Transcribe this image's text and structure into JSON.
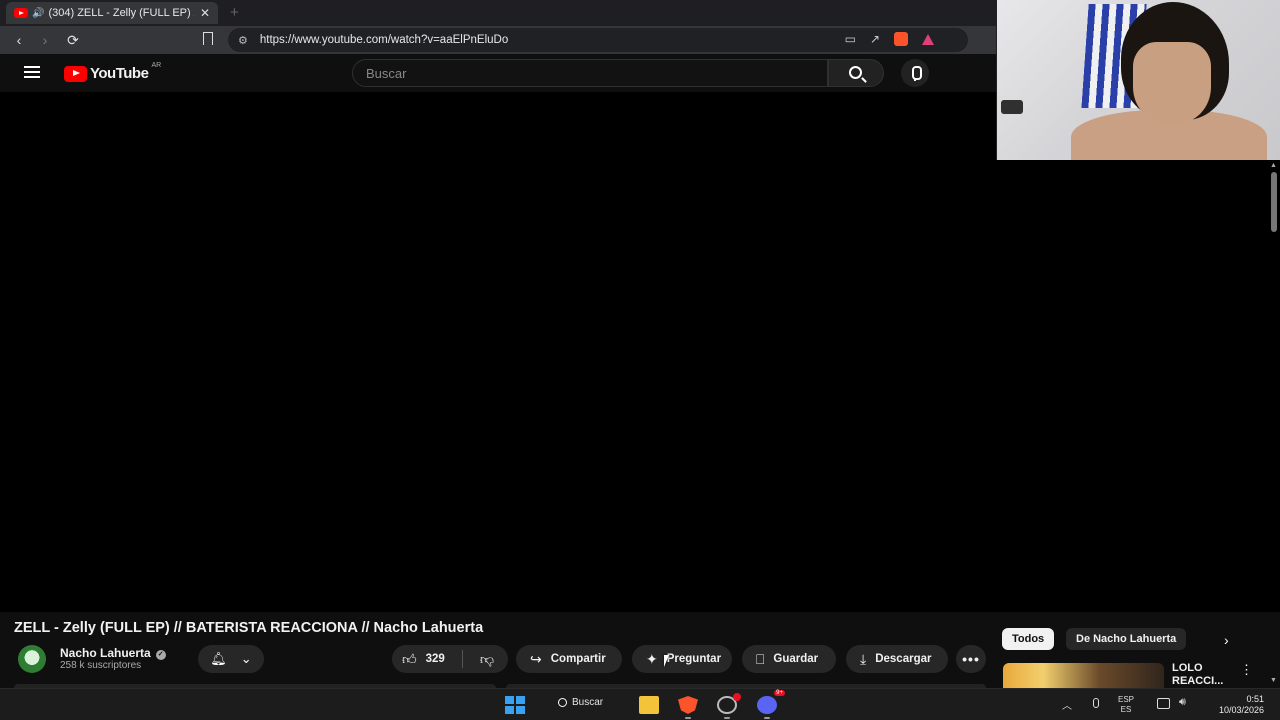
{
  "browser": {
    "tab_title": "(304) ZELL - Zelly (FULL EP) //",
    "new_tab_glyph": "+",
    "url": "https://www.youtube.com/watch?v=aaElPnEluDo",
    "nav": {
      "back": "‹",
      "forward": "›",
      "reload": "⟳"
    }
  },
  "youtube": {
    "logo_text": "YouTube",
    "country_code": "AR",
    "search_placeholder": "Buscar"
  },
  "video": {
    "title": "ZELL - Zelly (FULL EP) // BATERISTA REACCIONA // Nacho Lahuerta",
    "channel_name": "Nacho Lahuerta",
    "subscribers": "258 k suscriptores",
    "likes": "329",
    "actions": {
      "share": "Compartir",
      "ask": "Preguntar",
      "save": "Guardar",
      "download": "Descargar",
      "more": "•••"
    }
  },
  "sidebar": {
    "chips": [
      "Todos",
      "De Nacho Lahuerta"
    ],
    "next_glyph": "›",
    "rec_title_line1": "LOLO",
    "rec_title_line2": "REACCI..."
  },
  "taskbar": {
    "search_label": "Buscar",
    "lang_line1": "ESP",
    "lang_line2": "ES",
    "time": "0:51",
    "date": "10/03/2026"
  },
  "colors": {
    "accent": "#ff0000",
    "background": "#0f0f0f",
    "pill": "#272727"
  }
}
